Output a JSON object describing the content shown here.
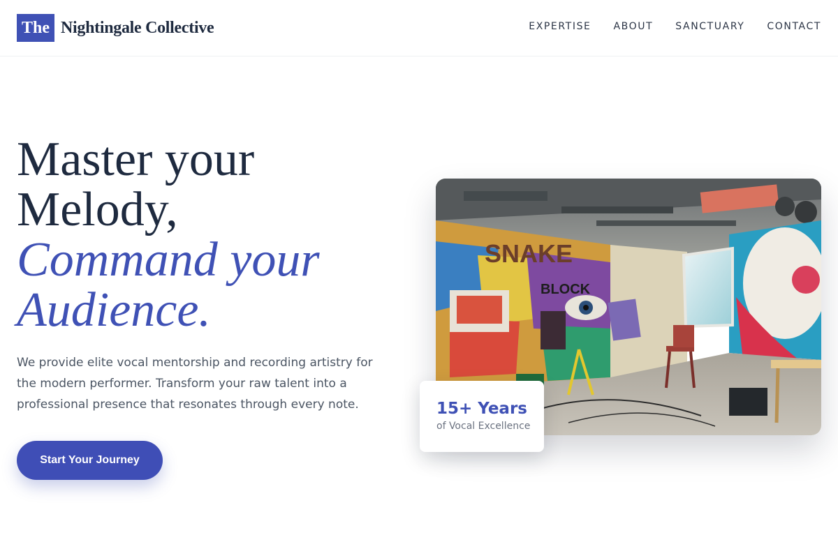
{
  "brand": {
    "mark": "The",
    "name": "Nightingale Collective"
  },
  "nav": {
    "items": [
      {
        "label": "EXPERTISE"
      },
      {
        "label": "ABOUT"
      },
      {
        "label": "SANCTUARY"
      },
      {
        "label": "CONTACT"
      }
    ]
  },
  "hero": {
    "title_line1": "Master your",
    "title_line2": "Melody,",
    "title_accent1": "Command your",
    "title_accent2": "Audience.",
    "description": "We provide elite vocal mentorship and recording artistry for the modern performer. Transform your raw talent into a professional presence that resonates through every note.",
    "cta_label": "Start Your Journey"
  },
  "stat": {
    "value": "15+ Years",
    "label": "of Vocal Excellence"
  },
  "colors": {
    "accent": "#3f51b5",
    "heading": "#1e2a3f",
    "body": "#4b5563"
  },
  "image": {
    "icon": "studio-photo"
  }
}
